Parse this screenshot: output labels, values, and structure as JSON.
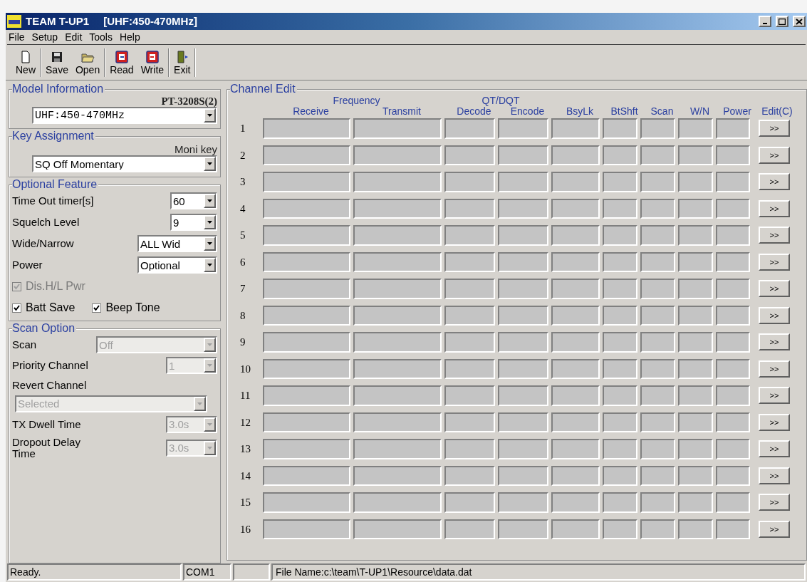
{
  "window": {
    "title": "TEAM T-UP1",
    "subtitle": "[UHF:450-470MHz]"
  },
  "menu": [
    "File",
    "Setup",
    "Edit",
    "Tools",
    "Help"
  ],
  "toolbar": [
    [
      {
        "label": "New",
        "kind": "new"
      }
    ],
    [
      {
        "label": "Save",
        "kind": "save"
      },
      {
        "label": "Open",
        "kind": "open"
      }
    ],
    [
      {
        "label": "Read",
        "kind": "read"
      },
      {
        "label": "Write",
        "kind": "write"
      }
    ],
    [
      {
        "label": "Exit",
        "kind": "exit"
      }
    ]
  ],
  "model_information": {
    "title": "Model Information",
    "model": "PT-3208S(2)",
    "band": "UHF:450-470MHz"
  },
  "key_assignment": {
    "title": "Key Assignment",
    "label": "Moni key",
    "value": "SQ Off Momentary"
  },
  "optional_feature": {
    "title": "Optional Feature",
    "fields": [
      {
        "label": "Time Out timer[s]",
        "value": "60",
        "kind": "short"
      },
      {
        "label": "Squelch Level",
        "value": "9",
        "kind": "short"
      },
      {
        "label": "Wide/Narrow",
        "value": "ALL Wid",
        "kind": "long"
      },
      {
        "label": "Power",
        "value": "Optional",
        "kind": "long"
      }
    ],
    "checkboxes": [
      [
        {
          "label": "Dis.H/L Pwr",
          "checked": true,
          "disabled": true
        }
      ],
      [
        {
          "label": "Batt Save",
          "checked": true,
          "disabled": false
        },
        {
          "label": "Beep Tone",
          "checked": true,
          "disabled": false
        }
      ]
    ]
  },
  "scan_option": {
    "title": "Scan Option",
    "fields": [
      {
        "label": "Scan",
        "value": "Off",
        "kind": "wide_inline",
        "disabled": true
      },
      {
        "label": "Priority Channel",
        "value": "1",
        "kind": "inline",
        "disabled": true
      },
      {
        "label": "Revert Channel",
        "value": "Selected",
        "kind": "stacked",
        "disabled": true
      },
      {
        "label": "TX Dwell Time",
        "value": "3.0s",
        "kind": "inline",
        "disabled": true
      },
      {
        "label": "Dropout Delay Time",
        "value": "3.0s",
        "kind": "inline",
        "disabled": true
      }
    ]
  },
  "channel_edit": {
    "title": "Channel Edit",
    "groups": [
      "Frequency",
      "QT/DQT"
    ],
    "columns": [
      "Receive",
      "Transmit",
      "Decode",
      "Encode",
      "BsyLk",
      "BtShft",
      "Scan",
      "W/N",
      "Power",
      "Edit(C)"
    ],
    "rows": [
      {
        "number": "1",
        "button": ">>"
      },
      {
        "number": "2",
        "button": ">>"
      },
      {
        "number": "3",
        "button": ">>"
      },
      {
        "number": "4",
        "button": ">>"
      },
      {
        "number": "5",
        "button": ">>"
      },
      {
        "number": "6",
        "button": ">>"
      },
      {
        "number": "7",
        "button": ">>"
      },
      {
        "number": "8",
        "button": ">>"
      },
      {
        "number": "9",
        "button": ">>"
      },
      {
        "number": "10",
        "button": ">>"
      },
      {
        "number": "11",
        "button": ">>"
      },
      {
        "number": "12",
        "button": ">>"
      },
      {
        "number": "13",
        "button": ">>"
      },
      {
        "number": "14",
        "button": ">>"
      },
      {
        "number": "15",
        "button": ">>"
      },
      {
        "number": "16",
        "button": ">>"
      }
    ]
  },
  "status_bar": [
    "Ready.",
    "COM1",
    "File Name:c:\\team\\T-UP1\\Resource\\data.dat"
  ]
}
